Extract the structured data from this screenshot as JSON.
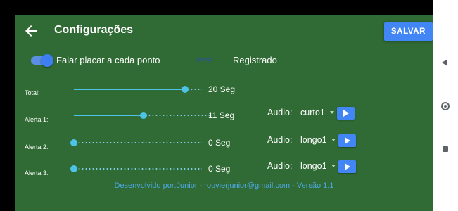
{
  "appbar": {
    "title": "Configurações",
    "save_label": "SALVAR",
    "back_icon": "arrow-left-icon"
  },
  "settings": {
    "speak_score": {
      "label": "Falar placar a cada ponto",
      "enabled": true
    },
    "new_badge": "(Novo)",
    "status": "Registrado"
  },
  "timers": [
    {
      "label": "Total:",
      "value_text": "20 Seg",
      "level": 0.87,
      "audio": null
    },
    {
      "label": "Alerta 1:",
      "value_text": "11 Seg",
      "level": 0.5,
      "audio": {
        "label": "Audio:",
        "selected": "curto1"
      }
    },
    {
      "label": "Alerta 2:",
      "value_text": "0 Seg",
      "level": 0,
      "audio": {
        "label": "Audio:",
        "selected": "longo1"
      }
    },
    {
      "label": "Alerta 3:",
      "value_text": "0 Seg",
      "level": 0,
      "audio": {
        "label": "Audio:",
        "selected": "longo1"
      }
    }
  ],
  "footer": "Desenvolvido por:Junior - rouvierjunior@gmail.com - Versão 1.1",
  "system_nav": [
    "back-icon",
    "home-icon",
    "recents-icon"
  ],
  "colors": {
    "panel": "#306a34",
    "accent": "#4285f4",
    "slider": "#4dc3e8",
    "footer_text": "#4da9e6",
    "badge_text": "#2e4cb8"
  }
}
